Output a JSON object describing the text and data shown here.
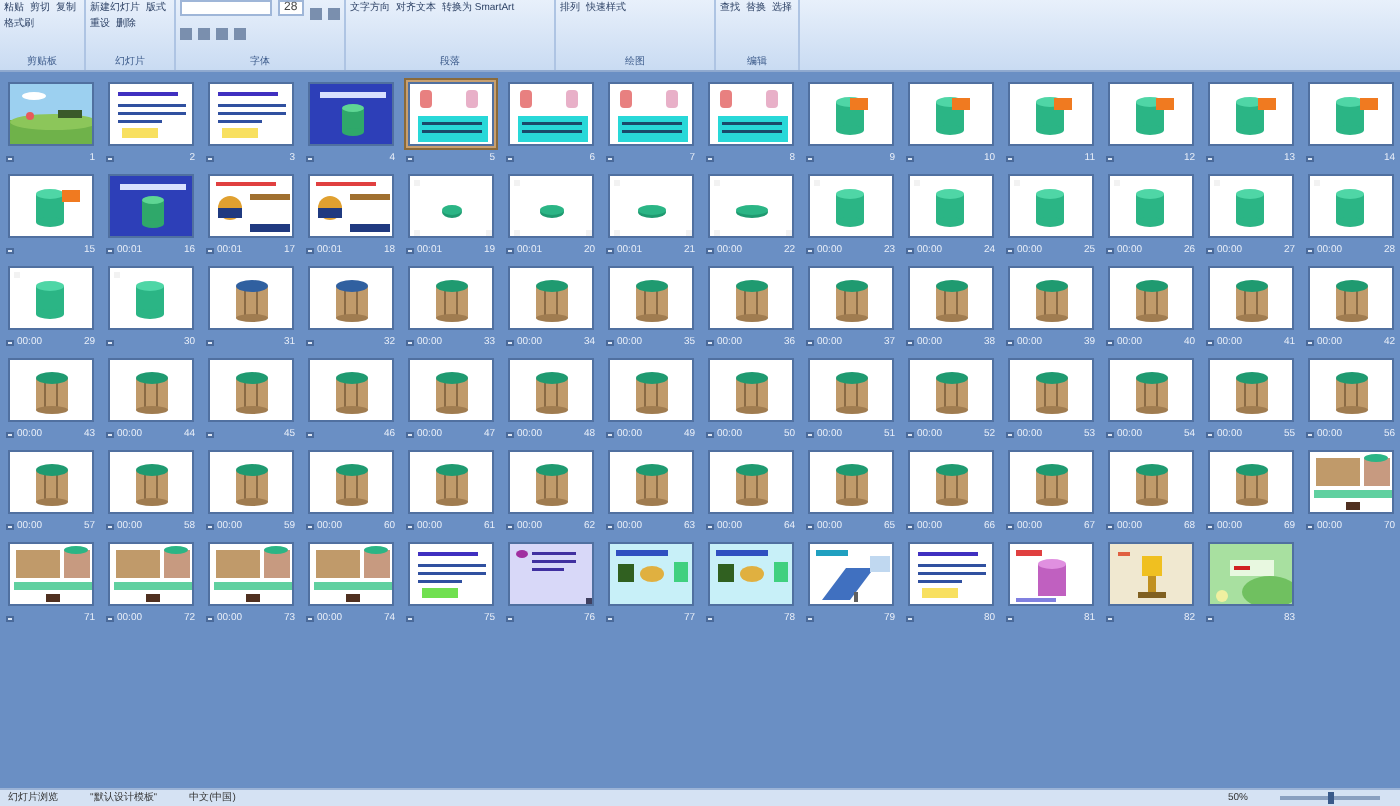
{
  "ribbon": {
    "groups": [
      {
        "label": "剪贴板",
        "buttons": [
          "粘贴",
          "剪切",
          "复制",
          "格式刷"
        ]
      },
      {
        "label": "幻灯片",
        "buttons": [
          "新建幻灯片",
          "版式",
          "重设",
          "删除"
        ]
      },
      {
        "label": "字体",
        "font_size": "28"
      },
      {
        "label": "段落",
        "buttons": [
          "文字方向",
          "对齐文本",
          "转换为 SmartArt"
        ]
      },
      {
        "label": "绘图",
        "buttons": [
          "排列",
          "快速样式"
        ]
      },
      {
        "label": "编辑",
        "buttons": [
          "查找",
          "替换",
          "选择"
        ]
      }
    ]
  },
  "slides": [
    {
      "number": "1",
      "selected": false
    },
    {
      "number": "2",
      "selected": false
    },
    {
      "number": "3",
      "selected": false
    },
    {
      "number": "4",
      "selected": false
    },
    {
      "number": "5",
      "selected": true
    },
    {
      "number": "6",
      "selected": false
    },
    {
      "number": "7",
      "selected": false
    },
    {
      "number": "8",
      "selected": false
    },
    {
      "number": "9",
      "selected": false
    },
    {
      "number": "10",
      "selected": false
    },
    {
      "number": "11",
      "selected": false
    },
    {
      "number": "12",
      "selected": false
    },
    {
      "number": "13",
      "selected": false
    },
    {
      "number": "14",
      "selected": false
    },
    {
      "number": "15",
      "selected": false
    },
    {
      "number": "16",
      "time": "00:01",
      "selected": false
    },
    {
      "number": "17",
      "time": "00:01",
      "selected": false
    },
    {
      "number": "18",
      "time": "00:01",
      "selected": false
    },
    {
      "number": "19",
      "time": "00:01",
      "selected": false
    },
    {
      "number": "20",
      "time": "00:01",
      "selected": false
    },
    {
      "number": "21",
      "time": "00:01",
      "selected": false
    },
    {
      "number": "22",
      "time": "00:00",
      "selected": false
    },
    {
      "number": "23",
      "time": "00:00",
      "selected": false
    },
    {
      "number": "24",
      "time": "00:00",
      "selected": false
    },
    {
      "number": "25",
      "time": "00:00",
      "selected": false
    },
    {
      "number": "26",
      "time": "00:00",
      "selected": false
    },
    {
      "number": "27",
      "time": "00:00",
      "selected": false
    },
    {
      "number": "28",
      "time": "00:00",
      "selected": false
    },
    {
      "number": "29",
      "time": "00:00",
      "selected": false
    },
    {
      "number": "30",
      "selected": false
    },
    {
      "number": "31",
      "selected": false
    },
    {
      "number": "32",
      "selected": false
    },
    {
      "number": "33",
      "time": "00:00",
      "selected": false
    },
    {
      "number": "34",
      "time": "00:00",
      "selected": false
    },
    {
      "number": "35",
      "time": "00:00",
      "selected": false
    },
    {
      "number": "36",
      "time": "00:00",
      "selected": false
    },
    {
      "number": "37",
      "time": "00:00",
      "selected": false
    },
    {
      "number": "38",
      "time": "00:00",
      "selected": false
    },
    {
      "number": "39",
      "time": "00:00",
      "selected": false
    },
    {
      "number": "40",
      "time": "00:00",
      "selected": false
    },
    {
      "number": "41",
      "time": "00:00",
      "selected": false
    },
    {
      "number": "42",
      "time": "00:00",
      "selected": false
    },
    {
      "number": "43",
      "time": "00:00",
      "selected": false
    },
    {
      "number": "44",
      "time": "00:00",
      "selected": false
    },
    {
      "number": "45",
      "selected": false
    },
    {
      "number": "46",
      "selected": false
    },
    {
      "number": "47",
      "time": "00:00",
      "selected": false
    },
    {
      "number": "48",
      "time": "00:00",
      "selected": false
    },
    {
      "number": "49",
      "time": "00:00",
      "selected": false
    },
    {
      "number": "50",
      "time": "00:00",
      "selected": false
    },
    {
      "number": "51",
      "time": "00:00",
      "selected": false
    },
    {
      "number": "52",
      "time": "00:00",
      "selected": false
    },
    {
      "number": "53",
      "time": "00:00",
      "selected": false
    },
    {
      "number": "54",
      "time": "00:00",
      "selected": false
    },
    {
      "number": "55",
      "time": "00:00",
      "selected": false
    },
    {
      "number": "56",
      "time": "00:00",
      "selected": false
    },
    {
      "number": "57",
      "time": "00:00",
      "selected": false
    },
    {
      "number": "58",
      "time": "00:00",
      "selected": false
    },
    {
      "number": "59",
      "time": "00:00",
      "selected": false
    },
    {
      "number": "60",
      "time": "00:00",
      "selected": false
    },
    {
      "number": "61",
      "time": "00:00",
      "selected": false
    },
    {
      "number": "62",
      "time": "00:00",
      "selected": false
    },
    {
      "number": "63",
      "time": "00:00",
      "selected": false
    },
    {
      "number": "64",
      "time": "00:00",
      "selected": false
    },
    {
      "number": "65",
      "time": "00:00",
      "selected": false
    },
    {
      "number": "66",
      "time": "00:00",
      "selected": false
    },
    {
      "number": "67",
      "time": "00:00",
      "selected": false
    },
    {
      "number": "68",
      "time": "00:00",
      "selected": false
    },
    {
      "number": "69",
      "time": "00:00",
      "selected": false
    },
    {
      "number": "70",
      "time": "00:00",
      "selected": false
    },
    {
      "number": "71",
      "selected": false
    },
    {
      "number": "72",
      "time": "00:00",
      "selected": false
    },
    {
      "number": "73",
      "time": "00:00",
      "selected": false
    },
    {
      "number": "74",
      "time": "00:00",
      "selected": false
    },
    {
      "number": "75",
      "selected": false
    },
    {
      "number": "76",
      "selected": false
    },
    {
      "number": "77",
      "selected": false
    },
    {
      "number": "78",
      "selected": false
    },
    {
      "number": "79",
      "selected": false
    },
    {
      "number": "80",
      "selected": false
    },
    {
      "number": "81",
      "selected": false
    },
    {
      "number": "82",
      "selected": false
    },
    {
      "number": "83",
      "selected": false
    }
  ],
  "status_bar": {
    "view": "幻灯片浏览",
    "theme": "\"默认设计模板\"",
    "language": "中文(中国)",
    "zoom": "50%",
    "zoom_slider": {
      "level": 0.5
    }
  }
}
